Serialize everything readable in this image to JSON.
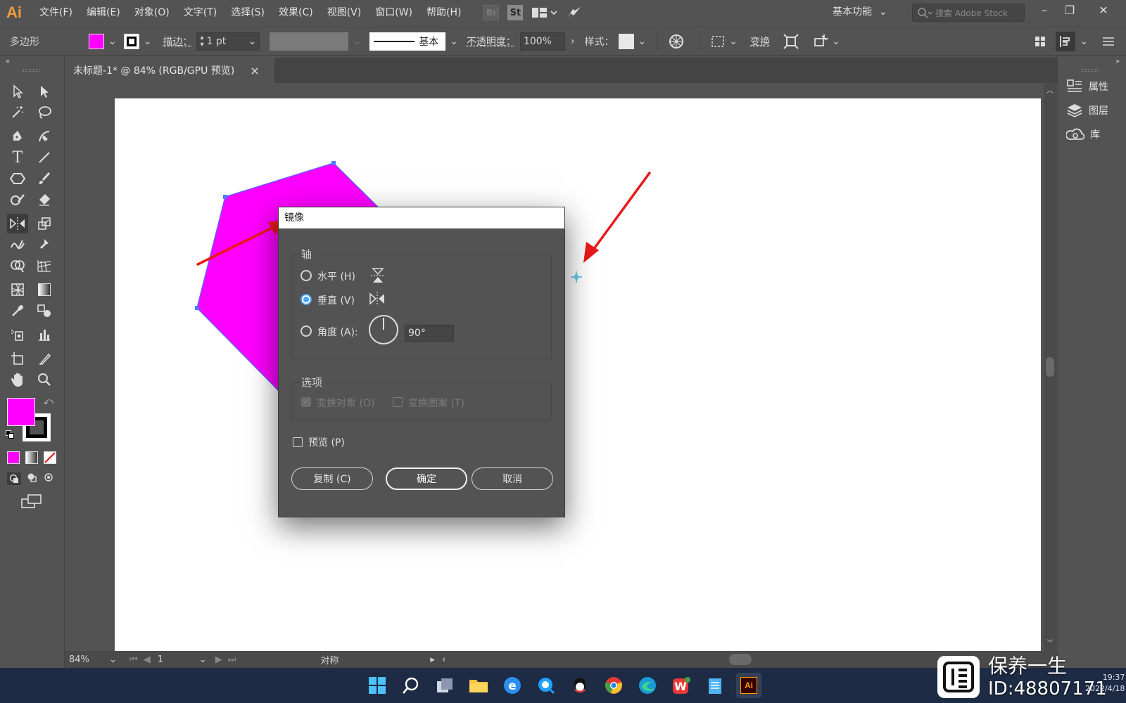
{
  "app": {
    "logo": "Ai"
  },
  "menu": [
    "文件(F)",
    "编辑(E)",
    "对象(O)",
    "文字(T)",
    "选择(S)",
    "效果(C)",
    "视图(V)",
    "窗口(W)",
    "帮助(H)"
  ],
  "menubar_icons": {
    "br": "Br",
    "st": "St"
  },
  "workspace": {
    "label": "基本功能"
  },
  "search": {
    "placeholder": "搜索 Adobe Stock"
  },
  "controlbar": {
    "selection_label": "多边形",
    "fill_color": "#ff00ff",
    "stroke_label": "描边：",
    "stroke_weight": "1 pt",
    "stroke_profile": "基本",
    "opacity_label": "不透明度：",
    "opacity_value": "100%",
    "style_label": "样式：",
    "transform_label": "变换"
  },
  "document_tab": {
    "title": "未标题-1* @ 84% (RGB/GPU 预览)",
    "close": "×"
  },
  "tools": {
    "fill_color": "#ff00ff",
    "stroke_color": "#000000"
  },
  "right_panel": [
    {
      "label": "属性",
      "icon": "properties-icon"
    },
    {
      "label": "图层",
      "icon": "layers-icon"
    },
    {
      "label": "库",
      "icon": "libraries-icon"
    }
  ],
  "dialog": {
    "title": "镜像",
    "axis_group": "轴",
    "horizontal": "水平 (H)",
    "vertical": "垂直 (V)",
    "angle_label": "角度 (A):",
    "angle_value": "90°",
    "options_group": "选项",
    "transform_objects": "变换对象 (O)",
    "transform_patterns": "变换图案 (T)",
    "preview": "预览 (P)",
    "copy_button": "复制 (C)",
    "ok_button": "确定",
    "cancel_button": "取消",
    "selected_axis": "vertical"
  },
  "status": {
    "zoom": "84%",
    "artboard": "1",
    "info": "对称"
  },
  "watermark": {
    "line1": "保养一生",
    "line2": "ID:48807171",
    "clock": "19:37",
    "date": "2022/4/18"
  },
  "colors": {
    "accent": "#4aa3ff",
    "shape": "#ff00ff",
    "arrow": "#e8191a"
  }
}
